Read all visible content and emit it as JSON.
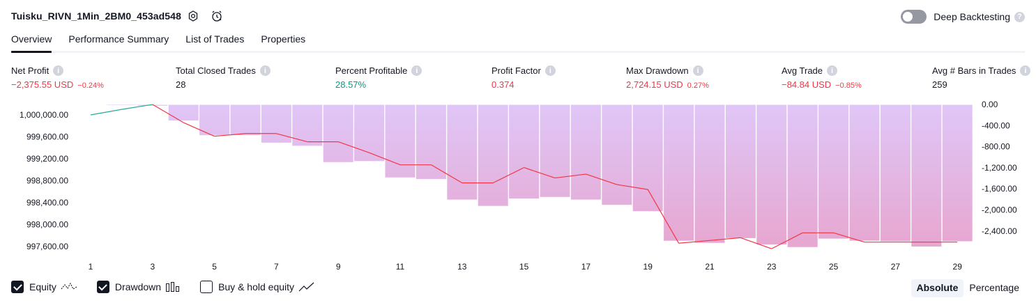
{
  "header": {
    "title": "Tuisku_RIVN_1Min_2BM0_453ad548",
    "deep_backtesting_label": "Deep Backtesting"
  },
  "tabs": [
    {
      "label": "Overview",
      "active": true
    },
    {
      "label": "Performance Summary",
      "active": false
    },
    {
      "label": "List of Trades",
      "active": false
    },
    {
      "label": "Properties",
      "active": false
    }
  ],
  "metrics": {
    "net_profit": {
      "label": "Net Profit",
      "value": "−2,375.55 USD",
      "pct": "−0.24%"
    },
    "total_closed_trades": {
      "label": "Total Closed Trades",
      "value": "28"
    },
    "percent_profitable": {
      "label": "Percent Profitable",
      "value": "28.57%"
    },
    "profit_factor": {
      "label": "Profit Factor",
      "value": "0.374"
    },
    "max_drawdown": {
      "label": "Max Drawdown",
      "value": "2,724.15 USD",
      "pct": "0.27%"
    },
    "avg_trade": {
      "label": "Avg Trade",
      "value": "−84.84 USD",
      "pct": "−0.85%"
    },
    "avg_bars": {
      "label": "Avg # Bars in Trades",
      "value": "259"
    }
  },
  "chart_data": {
    "type": "line",
    "left_axis": {
      "ticks": [
        "1,000,000.00",
        "999,600.00",
        "999,200.00",
        "998,800.00",
        "998,400.00",
        "998,000.00",
        "997,600.00"
      ],
      "range": [
        997600,
        1000000
      ]
    },
    "right_axis": {
      "ticks": [
        "0.00",
        "-400.00",
        "-800.00",
        "-1,200.00",
        "-1,600.00",
        "-2,000.00",
        "-2,400.00"
      ],
      "range": [
        -2400,
        0
      ]
    },
    "x_tick_labels": [
      "1",
      "3",
      "5",
      "7",
      "9",
      "11",
      "13",
      "15",
      "17",
      "19",
      "21",
      "23",
      "25",
      "27",
      "29"
    ],
    "series": [
      {
        "name": "Equity",
        "x": [
          1,
          2,
          3,
          4,
          5,
          6,
          7,
          8,
          9,
          10,
          11,
          12,
          13,
          14,
          15,
          16,
          17,
          18,
          19,
          20,
          21,
          22,
          23,
          24,
          25,
          26,
          27,
          28,
          29
        ],
        "values": [
          1000000,
          1000100,
          1000190,
          999860,
          999610,
          999660,
          999660,
          999510,
          999510,
          999310,
          999090,
          999090,
          998760,
          998760,
          999040,
          998850,
          998920,
          998730,
          998640,
          997660,
          997710,
          997760,
          997560,
          997850,
          997850,
          997680,
          997680,
          997680,
          997680
        ]
      },
      {
        "name": "Drawdown",
        "x": [
          1,
          2,
          3,
          4,
          5,
          6,
          7,
          8,
          9,
          10,
          11,
          12,
          13,
          14,
          15,
          16,
          17,
          18,
          19,
          20,
          21,
          22,
          23,
          24,
          25,
          26,
          27,
          28,
          29
        ],
        "values": [
          0,
          -20,
          -30,
          -310,
          -590,
          -590,
          -730,
          -790,
          -1100,
          -1080,
          -1390,
          -1420,
          -1810,
          -1930,
          -1790,
          -1760,
          -1810,
          -1910,
          -2030,
          -2590,
          -2630,
          -2540,
          -2660,
          -2710,
          -2550,
          -2590,
          -2600,
          -2700,
          -2600
        ]
      }
    ]
  },
  "legend": {
    "equity": {
      "label": "Equity",
      "checked": true
    },
    "drawdown": {
      "label": "Drawdown",
      "checked": true
    },
    "buy_hold": {
      "label": "Buy & hold equity",
      "checked": false
    }
  },
  "modes": [
    {
      "label": "Absolute",
      "active": true
    },
    {
      "label": "Percentage",
      "active": false
    }
  ],
  "colors": {
    "equity_up": "#22ab94",
    "equity_down": "#f23645",
    "drawdown_bar": "#d8bcfb",
    "area_top": "#e1c6f4",
    "area_bottom": "#ee8fb1"
  }
}
